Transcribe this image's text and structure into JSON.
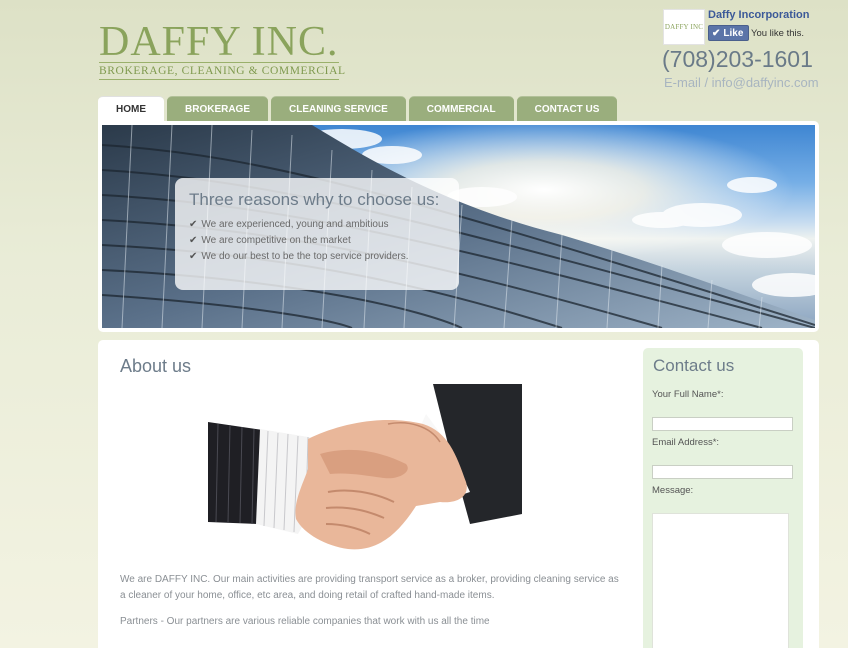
{
  "logo": {
    "title": "DAFFY INC.",
    "subtitle": "BROKERAGE, CLEANING & COMMERCIAL"
  },
  "facebook": {
    "thumb_text": "DAFFY INC",
    "page_name": "Daffy Incorporation",
    "like_label": "Like",
    "status": "You like this."
  },
  "contact_header": {
    "phone": "(708)203-1601",
    "email": "E-mail / info@daffyinc.com"
  },
  "nav": {
    "tabs": [
      {
        "label": "HOME",
        "active": true
      },
      {
        "label": "BROKERAGE"
      },
      {
        "label": "CLEANING SERVICE"
      },
      {
        "label": "COMMERCIAL"
      },
      {
        "label": "CONTACT US"
      }
    ]
  },
  "banner": {
    "title": "Three reasons why to choose us:",
    "reasons": [
      "We are experienced, young and ambitious",
      "We are competitive on the market",
      "We do our best to be the top service providers."
    ]
  },
  "about": {
    "title": "About us",
    "text": "We are DAFFY INC. Our main activities are providing transport service as a broker, providing cleaning service as a cleaner of your home, office, etc area, and doing retail of crafted hand-made items.",
    "partners": "Partners - Our partners are various reliable companies that work with us all the time"
  },
  "contact_form": {
    "title": "Contact us",
    "name_label": "Your Full Name*:",
    "email_label": "Email Address*:",
    "message_label": "Message:"
  },
  "colors": {
    "accent_green": "#8aa35c",
    "tab_green": "#9aae7d",
    "contact_bg": "#e6f2df"
  }
}
